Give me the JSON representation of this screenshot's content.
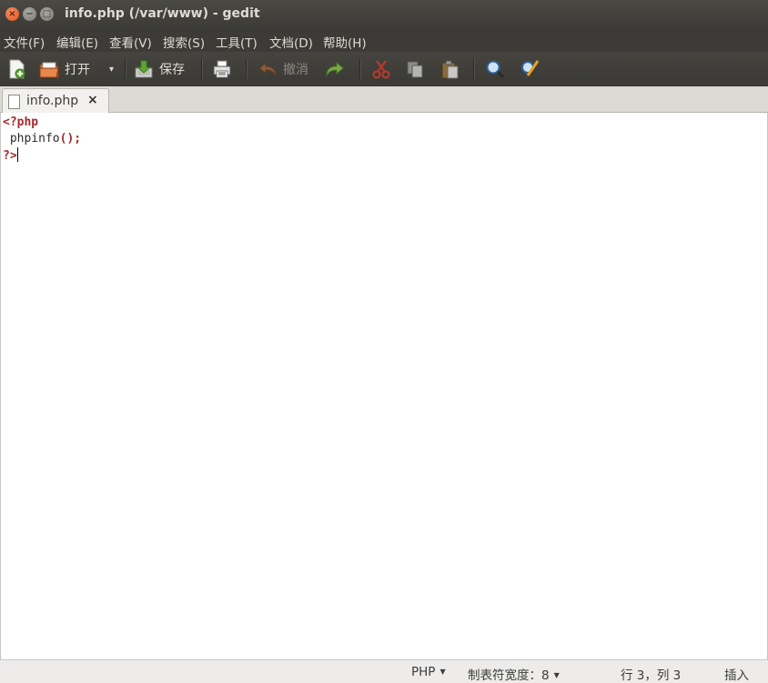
{
  "window": {
    "title": "info.php (/var/www) - gedit",
    "close_glyph": "×",
    "min_glyph": "−",
    "max_glyph": "□"
  },
  "menu": [
    "文件(F)",
    "编辑(E)",
    "查看(V)",
    "搜索(S)",
    "工具(T)",
    "文档(D)",
    "帮助(H)"
  ],
  "toolbar": {
    "open_label": "打开",
    "open_dropdown": "▾",
    "save_label": "保存",
    "undo_label": "撤消"
  },
  "tab": {
    "label": "info.php",
    "close": "×"
  },
  "editor": {
    "line1": "<?php",
    "line2_text": " phpinfo",
    "line2_punct": "();",
    "line3": "?>"
  },
  "status": {
    "language": "PHP",
    "tab_width": "制表符宽度：8",
    "position": "行 3，列 3",
    "mode": "插入"
  },
  "colors": {
    "accent_close": "#e0531b",
    "keyword": "#a52a2a"
  }
}
